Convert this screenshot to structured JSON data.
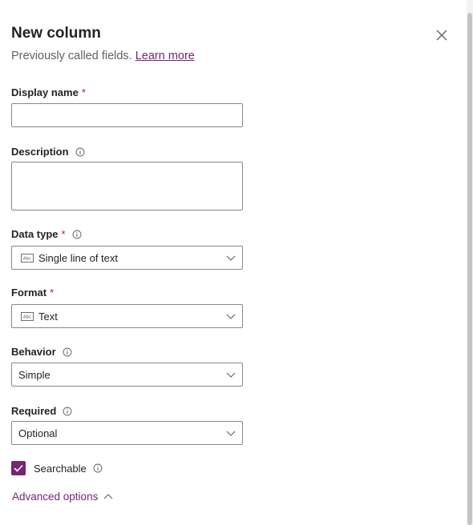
{
  "header": {
    "title": "New column",
    "subtitle": "Previously called fields.",
    "learn_more": "Learn more"
  },
  "fields": {
    "display_name": {
      "label": "Display name",
      "required_mark": "*",
      "value": ""
    },
    "description": {
      "label": "Description",
      "value": ""
    },
    "data_type": {
      "label": "Data type",
      "required_mark": "*",
      "value": "Single line of text",
      "icon": "text-field-icon"
    },
    "format": {
      "label": "Format",
      "required_mark": "*",
      "value": "Text",
      "icon": "text-field-icon"
    },
    "behavior": {
      "label": "Behavior",
      "value": "Simple"
    },
    "required": {
      "label": "Required",
      "value": "Optional"
    }
  },
  "searchable": {
    "label": "Searchable",
    "checked": true
  },
  "advanced": {
    "label": "Advanced options"
  },
  "colors": {
    "accent": "#742774",
    "required": "#a4262c",
    "border": "#8a8886"
  }
}
